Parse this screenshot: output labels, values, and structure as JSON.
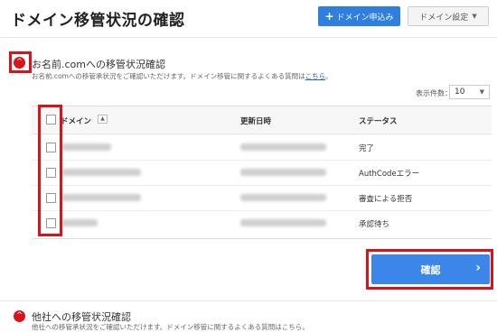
{
  "page": {
    "title": "ドメイン移管状況の確認"
  },
  "header": {
    "add_button": {
      "icon": "plus-icon",
      "label": "ドメイン申込み"
    },
    "settings_button": {
      "label": "ドメイン設定",
      "icon": "caret-down-icon"
    }
  },
  "section1": {
    "title": "お名前.comへの移管状況確認",
    "desc_prefix": "お名前.comへの移管承状況をご確認いただけます。ドメイン移管に関するよくある質問は",
    "desc_link": "こちら",
    "desc_suffix": "。"
  },
  "display_count": {
    "label": "表示件数：",
    "value": "10"
  },
  "table": {
    "headers": {
      "domain": "ドメイン",
      "updated": "更新日時",
      "status": "ステータス"
    },
    "rows": [
      {
        "status": "完了"
      },
      {
        "status": "AuthCodeエラー"
      },
      {
        "status": "審査による拒否"
      },
      {
        "status": "承認待ち"
      }
    ]
  },
  "confirm_button": {
    "label": "確認",
    "icon": "chevron-right-icon"
  },
  "section2": {
    "title": "他社への移管状況確認",
    "desc": "他社への移管承状況をご確認いただけます。ドメイン移管に関するよくある質問はこちら。"
  },
  "colors": {
    "primary": "#2f7fe0",
    "highlight": "#d9121b",
    "toggle": "#d9121b"
  }
}
